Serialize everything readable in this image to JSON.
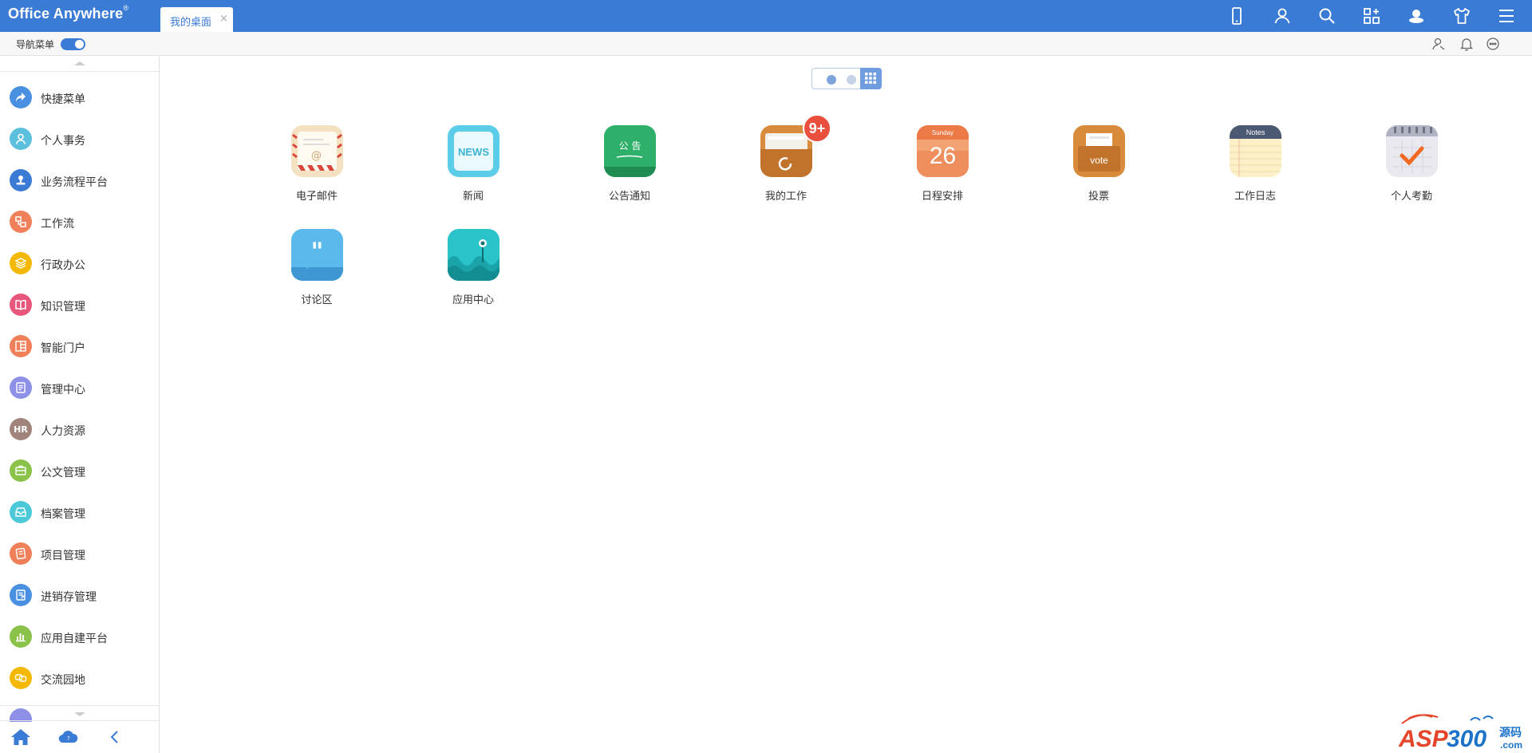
{
  "app": {
    "logo": "Office Anywhere",
    "logo_mark": "®"
  },
  "tabs": [
    {
      "label": "我的桌面",
      "close": "×"
    }
  ],
  "topbar_icons": [
    "mobile-icon",
    "user-icon",
    "search-icon",
    "apps-icon",
    "cloud-user-icon",
    "shirt-icon",
    "menu-icon"
  ],
  "subbar": {
    "nav_label": "导航菜单",
    "nav_toggle_on": true,
    "icons": [
      "org-icon",
      "bell-icon",
      "chat-icon"
    ]
  },
  "sidebar": {
    "items": [
      {
        "label": "快捷菜单",
        "color": "#4a90e2",
        "icon": "share-icon"
      },
      {
        "label": "个人事务",
        "color": "#5bc0de",
        "icon": "person-icon"
      },
      {
        "label": "业务流程平台",
        "color": "#3a7bd5",
        "icon": "stamp-icon"
      },
      {
        "label": "工作流",
        "color": "#f0805a",
        "icon": "flow-icon"
      },
      {
        "label": "行政办公",
        "color": "#f5b800",
        "icon": "layers-icon"
      },
      {
        "label": "知识管理",
        "color": "#e8567b",
        "icon": "book-icon"
      },
      {
        "label": "智能门户",
        "color": "#f0805a",
        "icon": "portal-icon"
      },
      {
        "label": "管理中心",
        "color": "#8e8fe6",
        "icon": "doc-icon"
      },
      {
        "label": "人力资源",
        "color": "#a0837a",
        "icon": "hr-icon",
        "text": "HR"
      },
      {
        "label": "公文管理",
        "color": "#8bc34a",
        "icon": "case-icon"
      },
      {
        "label": "档案管理",
        "color": "#4cc9d8",
        "icon": "archive-icon"
      },
      {
        "label": "项目管理",
        "color": "#f0805a",
        "icon": "project-icon"
      },
      {
        "label": "进销存管理",
        "color": "#4a90e2",
        "icon": "inventory-icon"
      },
      {
        "label": "应用自建平台",
        "color": "#8bc34a",
        "icon": "chart-icon"
      },
      {
        "label": "交流园地",
        "color": "#f5b800",
        "icon": "talk-icon"
      },
      {
        "label": "",
        "color": "#8e8fe6",
        "icon": "more-icon"
      }
    ],
    "footer_icons": [
      "home-icon",
      "cloud-icon",
      "collapse-icon"
    ]
  },
  "desktop": {
    "pager": {
      "pages": 2,
      "current": 1
    },
    "apps": [
      {
        "label": "电子邮件",
        "icon": "mail-icon"
      },
      {
        "label": "新闻",
        "icon": "news-icon",
        "icon_text": "NEWS"
      },
      {
        "label": "公告通知",
        "icon": "notice-icon",
        "icon_text": "公 告"
      },
      {
        "label": "我的工作",
        "icon": "work-icon",
        "badge": "9+"
      },
      {
        "label": "日程安排",
        "icon": "calendar-icon",
        "icon_text": "Sunday",
        "icon_number": "26"
      },
      {
        "label": "投票",
        "icon": "vote-icon",
        "icon_text": "vote"
      },
      {
        "label": "工作日志",
        "icon": "notes-icon",
        "icon_text": "Notes"
      },
      {
        "label": "个人考勤",
        "icon": "attendance-icon"
      },
      {
        "label": "讨论区",
        "icon": "discussion-icon"
      },
      {
        "label": "应用中心",
        "icon": "appcenter-icon"
      }
    ]
  },
  "watermark": {
    "text": "ASP300",
    "suffix": "源码",
    "domain": ".com"
  }
}
